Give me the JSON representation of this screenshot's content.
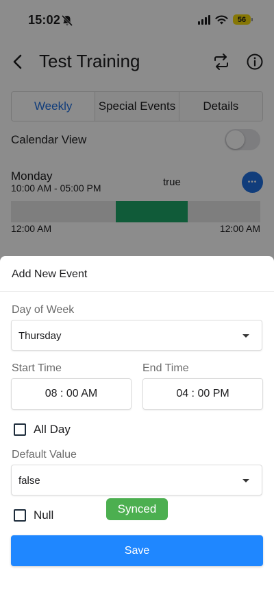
{
  "status_bar": {
    "time": "15:02",
    "battery": "56",
    "icons": [
      "bell-slash-icon",
      "cellular-signal-icon",
      "wifi-icon",
      "battery-icon"
    ]
  },
  "header": {
    "title": "Test Training",
    "icons": [
      "back-icon",
      "sync-icon",
      "info-icon"
    ]
  },
  "tabs": [
    {
      "label": "Weekly",
      "active": true
    },
    {
      "label": "Special Events",
      "active": false
    },
    {
      "label": "Details",
      "active": false
    }
  ],
  "calendar_view": {
    "label": "Calendar View",
    "enabled": false
  },
  "schedule": {
    "day": "Monday",
    "range": "10:00 AM - 05:00 PM",
    "value": "true",
    "timeline_start": "12:00 AM",
    "timeline_end": "12:00 AM",
    "fill_start_fraction": 0.42,
    "fill_end_fraction": 0.71
  },
  "sheet": {
    "title": "Add New Event",
    "day_of_week_label": "Day of Week",
    "day_of_week_value": "Thursday",
    "start_time_label": "Start Time",
    "start_time_value": "08 : 00 AM",
    "end_time_label": "End Time",
    "end_time_value": "04 : 00 PM",
    "all_day_label": "All Day",
    "all_day_checked": false,
    "default_value_label": "Default Value",
    "default_value_value": "false",
    "null_label": "Null",
    "null_checked": false,
    "toast": "Synced",
    "save_label": "Save"
  },
  "colors": {
    "accent": "#1f6fe0",
    "save_button": "#1f87ff",
    "timeline_fill": "#1ea668",
    "toast": "#4caf50"
  }
}
